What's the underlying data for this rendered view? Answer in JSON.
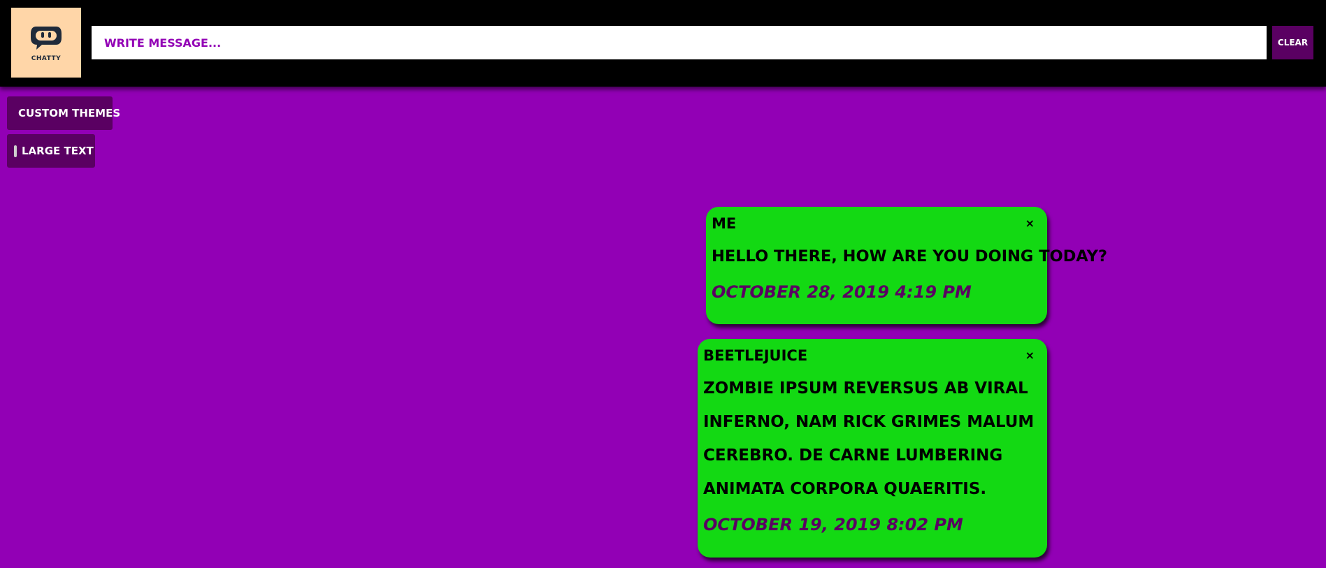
{
  "header": {
    "logo_text": "CHATTY",
    "message_placeholder": "WRITE MESSAGE...",
    "clear_label": "CLEAR"
  },
  "sidebar": {
    "custom_themes_label": "CUSTOM THEMES",
    "large_text_label": "LARGE TEXT",
    "large_text_checked": false
  },
  "messages": [
    {
      "author": "ME",
      "text": "HELLO THERE, HOW ARE YOU DOING TODAY?",
      "timestamp": "OCTOBER 28, 2019 4:19 PM",
      "close_label": "×"
    },
    {
      "author": "BEETLEJUICE",
      "text": "ZOMBIE IPSUM REVERSUS AB VIRAL INFERNO, NAM RICK GRIMES MALUM CEREBRO. DE CARNE LUMBERING ANIMATA CORPORA QUAERITIS.",
      "timestamp": "OCTOBER 19, 2019 8:02 PM",
      "close_label": "×"
    }
  ],
  "colors": {
    "background": "#9200b5",
    "header": "#000000",
    "button": "#5a0062",
    "bubble": "#13d913",
    "logo_bg": "#ffd6a8"
  },
  "icons": {
    "logo": "chat-bot-face-icon",
    "checkbox": "checkbox-icon",
    "close": "close-icon"
  }
}
